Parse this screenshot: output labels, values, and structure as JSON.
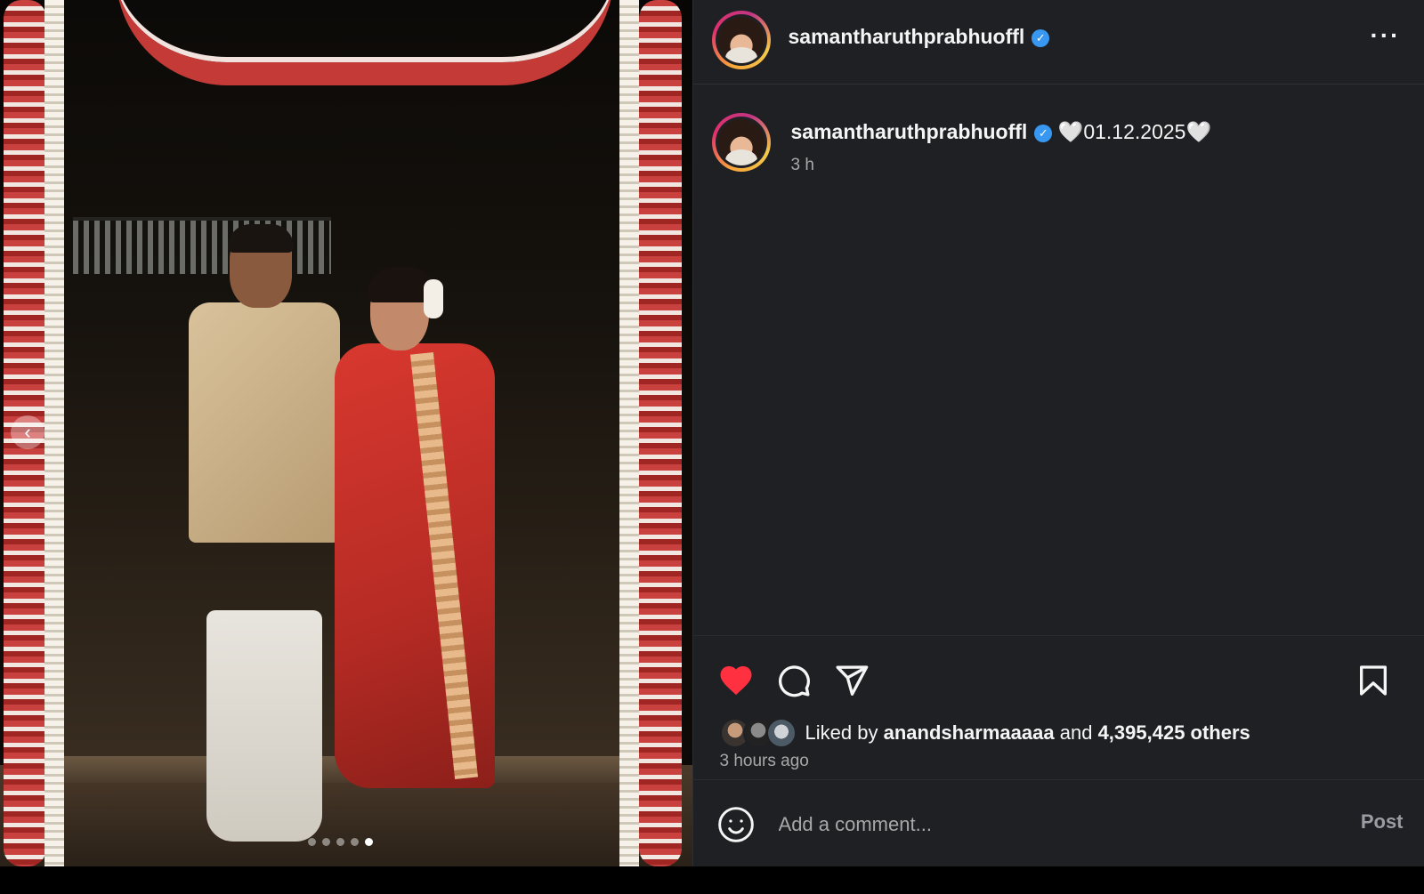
{
  "header": {
    "username": "samantharuthprabhuoffl",
    "verified_mark": "✓",
    "more_label": "···"
  },
  "caption": {
    "username": "samantharuthprabhuoffl",
    "verified_mark": "✓",
    "text": "🤍01.12.2025🤍",
    "time": "3 h"
  },
  "media": {
    "prev_arrow": "‹",
    "carousel": {
      "total": 5,
      "active_index": 4
    }
  },
  "actions": {
    "liked": true,
    "like_color": "#ff3040",
    "icons": [
      "heart-icon",
      "comment-icon",
      "share-icon",
      "bookmark-icon"
    ]
  },
  "likes": {
    "prefix": "Liked by ",
    "user": "anandsharmaaaaa",
    "middle": " and ",
    "others": "4,395,425 others"
  },
  "time_ago": "3 hours ago",
  "comment": {
    "placeholder": "Add a comment...",
    "post_label": "Post"
  },
  "colors": {
    "panel_bg": "#1f2024",
    "verified": "#3897f0",
    "secondary_text": "#a8a8a8"
  }
}
